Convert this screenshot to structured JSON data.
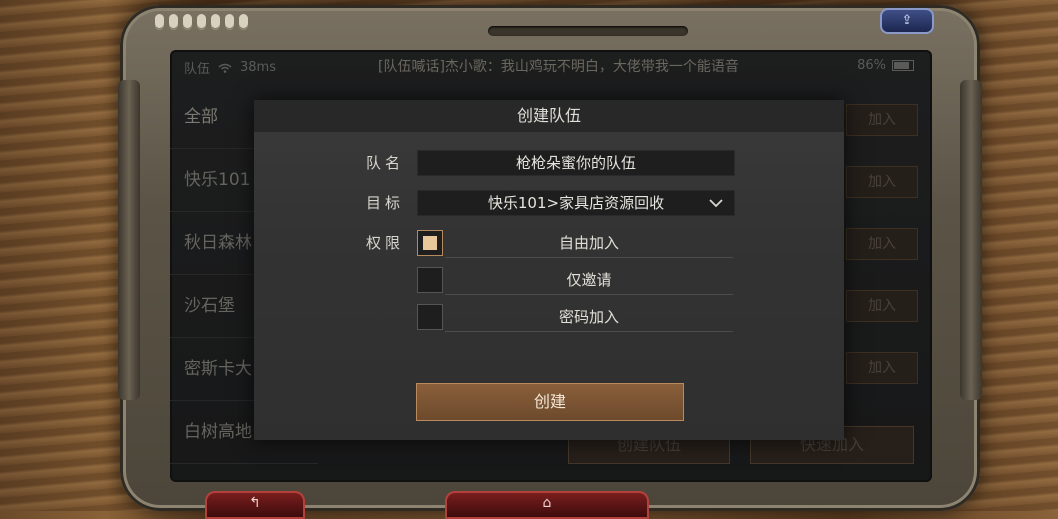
{
  "statusbar": {
    "team_label": "队伍",
    "ping": "38ms",
    "marquee": "[队伍喊话]杰小歌：我山鸡玩不明白，大佬带我一个能语音",
    "battery": "86%"
  },
  "frame": {
    "top_icon": "share-icon",
    "bottom_left_label": "↰",
    "bottom_center_label": "⌂"
  },
  "sidebar": {
    "items": [
      {
        "label": "全部"
      },
      {
        "label": "快乐101"
      },
      {
        "label": "秋日森林"
      },
      {
        "label": "沙石堡"
      },
      {
        "label": "密斯卡大"
      },
      {
        "label": "白树高地"
      }
    ]
  },
  "list": {
    "join_label": "加入"
  },
  "bottom_actions": {
    "create_team": "创建队伍",
    "quick_join": "快速加入"
  },
  "modal": {
    "title": "创建队伍",
    "name_label": "队名",
    "name_value": "枪枪朵蜜你的队伍",
    "target_label": "目标",
    "target_value": "快乐101>家具店资源回收",
    "permission_label": "权限",
    "permissions": [
      {
        "label": "自由加入",
        "checked": true
      },
      {
        "label": "仅邀请",
        "checked": false
      },
      {
        "label": "密码加入",
        "checked": false
      }
    ],
    "create_button": "创建"
  },
  "colors": {
    "accent": "#8a5f3b",
    "checkbox_fill": "#e8c79a",
    "screen_bg": "#2d2e2f"
  }
}
